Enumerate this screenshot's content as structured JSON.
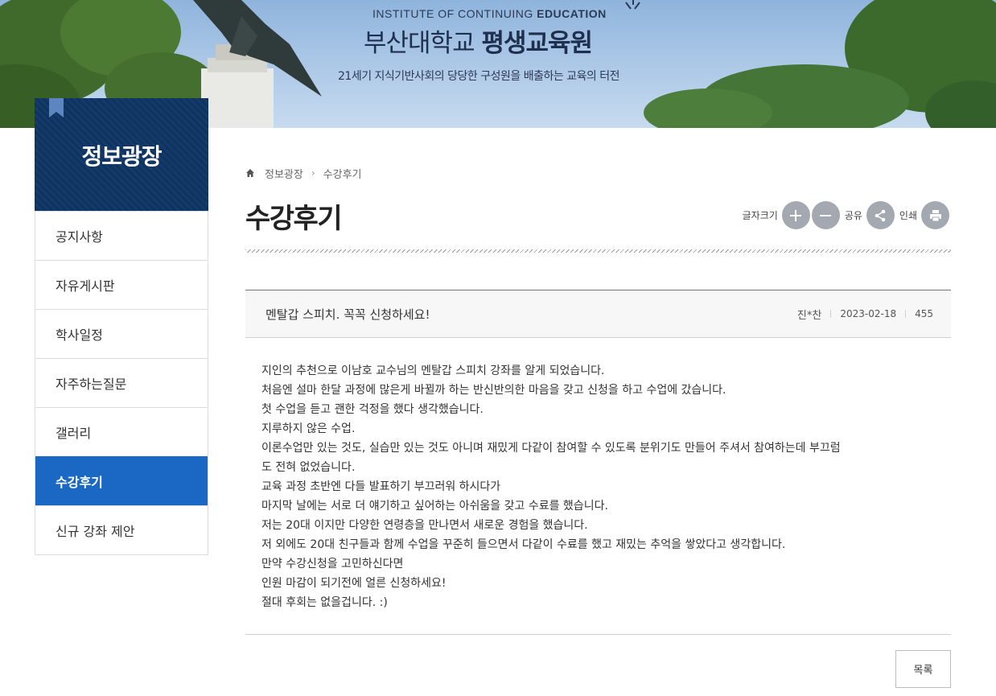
{
  "banner": {
    "subtitle_en_prefix": "INSTITUTE OF CONTINUING ",
    "subtitle_en_bold": "EDUCATION",
    "title_normal": "부산대학교 ",
    "title_bold": "평생교육원",
    "slogan": "21세기 지식기반사회의 당당한 구성원을 배출하는 교육의 터전"
  },
  "sidebar": {
    "heading": "정보광장",
    "items": [
      {
        "label": "공지사항"
      },
      {
        "label": "자유게시판"
      },
      {
        "label": "학사일정"
      },
      {
        "label": "자주하는질문"
      },
      {
        "label": "갤러리"
      },
      {
        "label": "수강후기",
        "active": true
      },
      {
        "label": "신규 강좌 제안"
      }
    ]
  },
  "breadcrumb": {
    "home_icon": "home-icon",
    "items": [
      "정보광장",
      "수강후기"
    ]
  },
  "page": {
    "title": "수강후기"
  },
  "tools": {
    "font_size_label": "글자크기",
    "share_label": "공유",
    "print_label": "인쇄",
    "icons": [
      "plus-icon",
      "minus-icon",
      "share-icon",
      "print-icon"
    ]
  },
  "post": {
    "title": "멘탈갑 스피치. 꼭꼭 신청하세요!",
    "author": "진*찬",
    "date": "2023-02-18",
    "views": "455",
    "body": [
      "지인의 추천으로 이남호 교수님의 멘탈갑 스피치 강좌를 알게 되었습니다.",
      "처음엔 설마 한달 과정에 많은게 바뀔까 하는 반신반의한 마음을 갖고 신청을 하고 수업에 갔습니다.",
      "첫 수업을 듣고 괜한 걱정을 했다 생각했습니다.",
      "지루하지 않은 수업.",
      "이론수업만 있는 것도, 실습만 있는 것도 아니며 재밌게 다같이 참여할 수 있도록 분위기도 만들어 주셔서 참여하는데 부끄럼",
      "도 전혀 없었습니다.",
      "교육 과정 초반엔 다들 발표하기 부끄러워 하시다가",
      "마지막 날에는 서로 더 얘기하고 싶어하는 아쉬움을 갖고 수료를 했습니다.",
      "저는 20대 이지만 다양한 연령층을 만나면서 새로운 경험을 했습니다.",
      "저 외에도 20대 친구들과 함께 수업을 꾸준히 들으면서 다같이 수료를 했고 재밌는 추억을 쌓았다고 생각합니다.",
      "만약 수강신청을 고민하신다면",
      "인원 마감이 되기전에 얼른 신청하세요!",
      "절대 후회는 없을겁니다. :)"
    ]
  },
  "buttons": {
    "list_label": "목록"
  }
}
